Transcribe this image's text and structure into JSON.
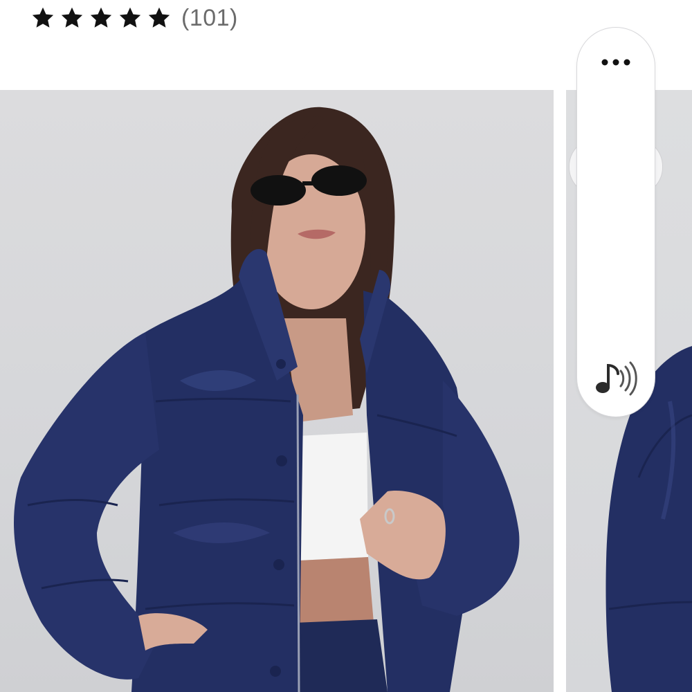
{
  "product": {
    "rating": {
      "stars_filled": 5,
      "stars_total": 5,
      "review_count_text": "(101)",
      "star_color": "#111111"
    }
  },
  "gallery": {
    "images": [
      {
        "alt_subject": "woman-in-navy-puffer-jacket",
        "jacket_color": "#232f63"
      },
      {
        "alt_subject": "navy-puffer-jacket-sleeve",
        "jacket_color": "#232f63"
      }
    ]
  },
  "toolbar": {
    "more_icon": "ellipsis-icon",
    "audio_icon": "music-note-sound-icon"
  }
}
